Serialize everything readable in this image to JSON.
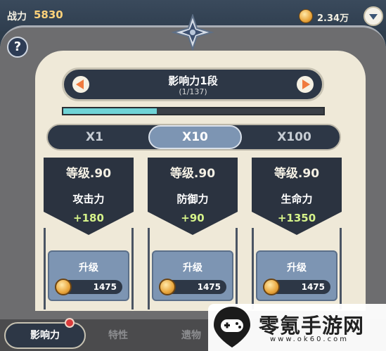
{
  "header": {
    "power_label": "战力",
    "power_value": "5830",
    "gold_value": "2.34万",
    "gold_icon": "gold-coin-icon",
    "dropdown_icon": "chevron-down-icon"
  },
  "help_label": "?",
  "level": {
    "title": "影响力1段",
    "progress_text": "(1/137)",
    "progress_fraction": 0.36
  },
  "multipliers": {
    "options": [
      "X1",
      "X10",
      "X100"
    ],
    "selected": "X10"
  },
  "cards": [
    {
      "level": "等级.90",
      "name": "攻击力",
      "bonus": "+180",
      "button": "升级",
      "cost": "1475"
    },
    {
      "level": "等级.90",
      "name": "防御力",
      "bonus": "+90",
      "button": "升级",
      "cost": "1475"
    },
    {
      "level": "等级.90",
      "name": "生命力",
      "bonus": "+1350",
      "button": "升级",
      "cost": "1475"
    }
  ],
  "nav": {
    "tabs": [
      "影响力",
      "特性",
      "遗物"
    ],
    "active": "影响力"
  },
  "watermark": {
    "text": "零氪手游网",
    "url": "www.ok60.com"
  },
  "colors": {
    "accent": "#7d95b3",
    "progress": "#6fd3d6",
    "bonus_green": "#d6f38a",
    "dark_panel": "#2d3746"
  }
}
